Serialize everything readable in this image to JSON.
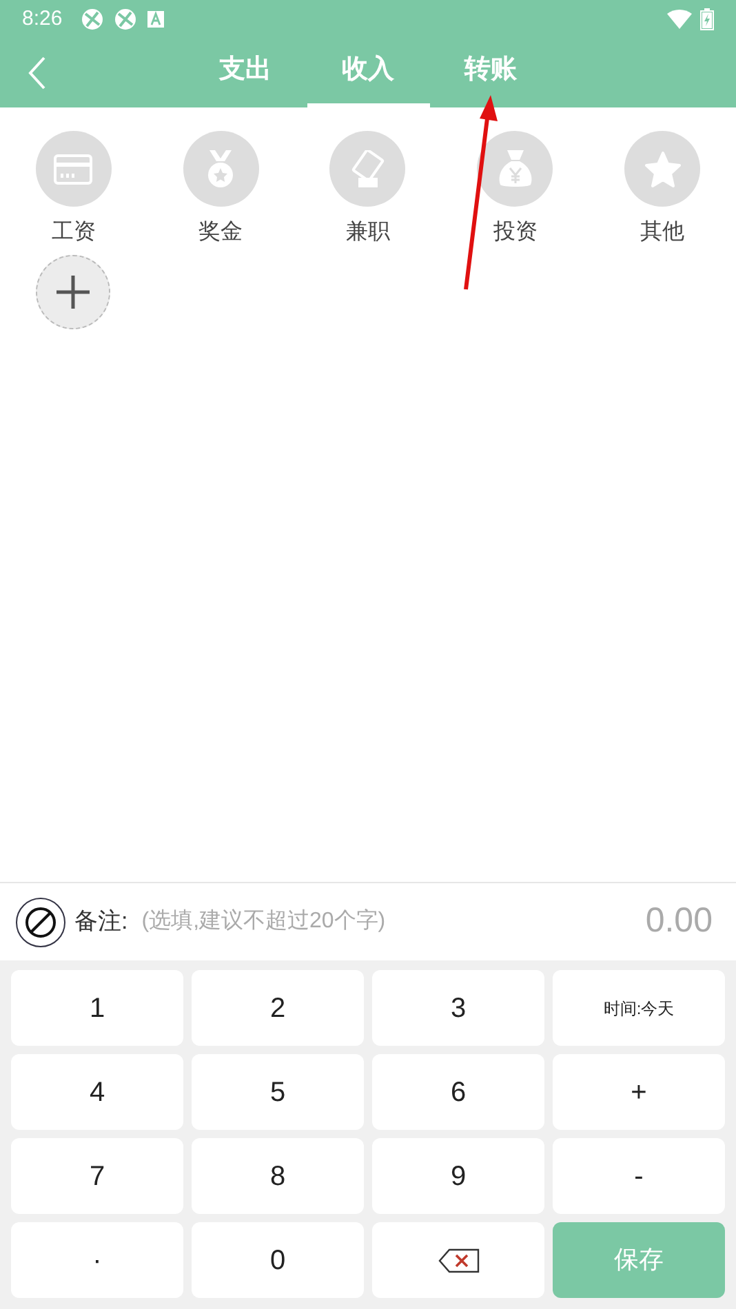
{
  "status_bar": {
    "time": "8:26"
  },
  "tabs": [
    {
      "label": "支出",
      "selected": false
    },
    {
      "label": "收入",
      "selected": true
    },
    {
      "label": "转账",
      "selected": false
    }
  ],
  "categories": [
    {
      "label": "工资"
    },
    {
      "label": "奖金"
    },
    {
      "label": "兼职"
    },
    {
      "label": "投资"
    },
    {
      "label": "其他"
    }
  ],
  "note": {
    "label": "备注:",
    "placeholder": "(选填,建议不超过20个字)",
    "amount": "0.00"
  },
  "keys": [
    {
      "kind": "text",
      "label": "1"
    },
    {
      "kind": "text",
      "label": "2"
    },
    {
      "kind": "text",
      "label": "3"
    },
    {
      "kind": "small",
      "label": "时间:今天"
    },
    {
      "kind": "text",
      "label": "4"
    },
    {
      "kind": "text",
      "label": "5"
    },
    {
      "kind": "text",
      "label": "6"
    },
    {
      "kind": "text",
      "label": "+"
    },
    {
      "kind": "text",
      "label": "7"
    },
    {
      "kind": "text",
      "label": "8"
    },
    {
      "kind": "text",
      "label": "9"
    },
    {
      "kind": "text",
      "label": "-"
    },
    {
      "kind": "text",
      "label": "·"
    },
    {
      "kind": "text",
      "label": "0"
    },
    {
      "kind": "backspace"
    },
    {
      "kind": "save",
      "label": "保存"
    }
  ]
}
